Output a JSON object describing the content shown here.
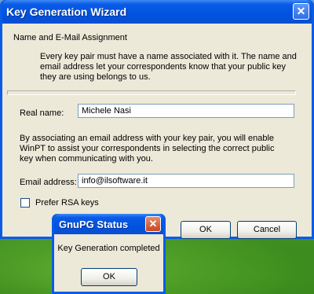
{
  "window": {
    "title": "Key Generation Wizard",
    "close_glyph": "✕"
  },
  "content": {
    "heading": "Name and E-Mail Assignment",
    "intro": "Every key pair must have a name associated with it. The name and email address let your correspondents know that your public key they are using belongs to us.",
    "real_name_label": "Real name:",
    "real_name_value": "Michele Nasi",
    "association_text": "By associating an email address with your key pair, you will enable WinPT to assist your correspondents in selecting the correct public key when communicating with you.",
    "email_label": "Email address:",
    "email_value": "info@ilsoftware.it",
    "checkbox_label": "Prefer RSA keys",
    "checkbox_checked": false
  },
  "buttons": {
    "ok": "OK",
    "cancel": "Cancel"
  },
  "popup": {
    "title": "GnuPG Status",
    "close_glyph": "✕",
    "message": "Key Generation completed",
    "ok": "OK"
  }
}
